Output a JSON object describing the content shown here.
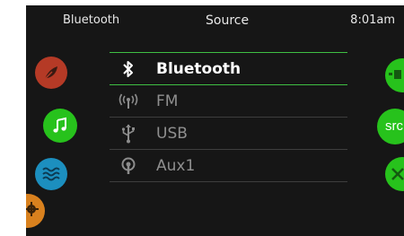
{
  "header": {
    "left_label": "Bluetooth",
    "title": "Source",
    "time": "8:01am"
  },
  "source_list": [
    {
      "label": "Bluetooth",
      "icon": "bluetooth-icon",
      "selected": true
    },
    {
      "label": "FM",
      "icon": "radio-antenna-icon",
      "selected": false
    },
    {
      "label": "USB",
      "icon": "usb-icon",
      "selected": false
    },
    {
      "label": "Aux1",
      "icon": "aux-input-icon",
      "selected": false
    }
  ],
  "left_buttons": [
    {
      "icon": "leaf-icon",
      "color": "#b53a26"
    },
    {
      "icon": "music-note-icon",
      "color": "#27c21c"
    },
    {
      "icon": "water-waves-icon",
      "color": "#1c8fbf"
    },
    {
      "icon": "gear-icon",
      "color": "#d9811e"
    }
  ],
  "right_buttons": {
    "src_label": "src",
    "color": "#27c21c"
  },
  "colors": {
    "background": "#161616",
    "accent_green": "#3fbf43",
    "divider": "#3e3e3e"
  }
}
